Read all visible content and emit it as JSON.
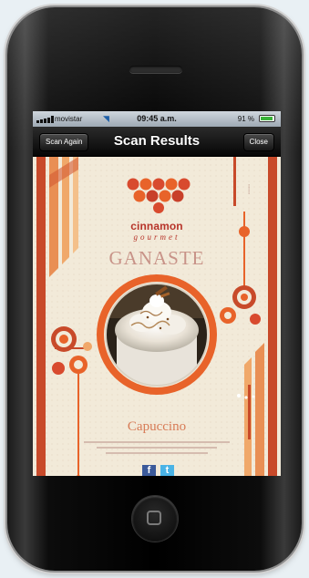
{
  "status_bar": {
    "carrier": "movistar",
    "time": "09:45 a.m.",
    "battery": "91 %",
    "battery_level": 0.91
  },
  "nav": {
    "left_button": "Scan Again",
    "title": "Scan Results",
    "right_button": "Close"
  },
  "result": {
    "brand_name": "cinnamon",
    "brand_sub": "gourmet",
    "headline": "GANASTE",
    "product_name": "Capuccino"
  },
  "colors": {
    "accent_orange": "#e8632a",
    "brand_red": "#b7342a",
    "background_cream": "#f2ead9"
  },
  "icons": {
    "facebook": "f",
    "twitter": "t"
  }
}
